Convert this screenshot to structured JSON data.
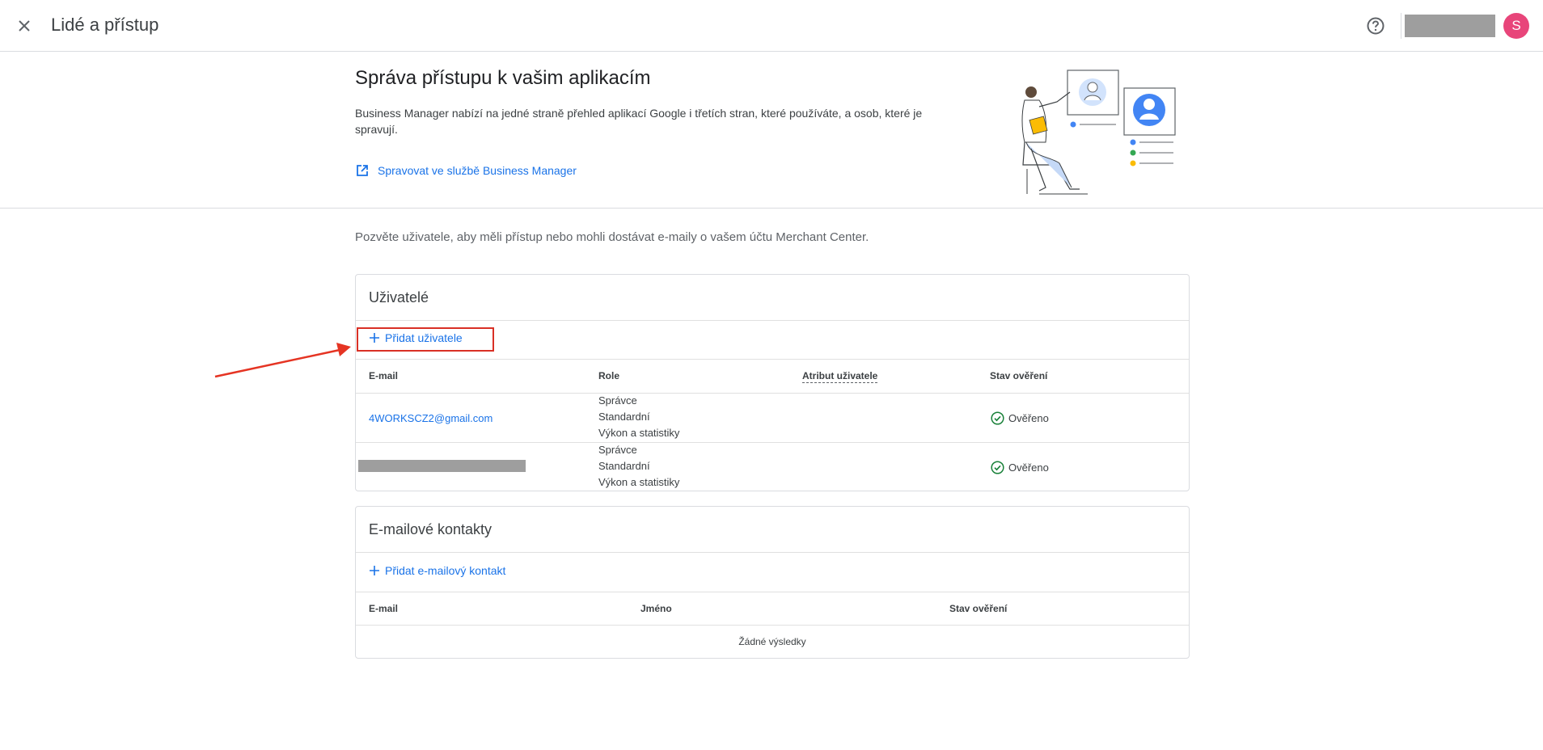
{
  "header": {
    "title": "Lidé a přístup",
    "avatar_letter": "S"
  },
  "hero": {
    "title": "Správa přístupu k vašim aplikacím",
    "description": "Business Manager nabízí na jedné straně přehled aplikací Google i třetích stran, které používáte, a osob, které je spravují.",
    "link_label": "Spravovat ve službě Business Manager"
  },
  "intro": "Pozvěte uživatele, aby měli přístup nebo mohli dostávat e-maily o vašem účtu Merchant Center.",
  "users": {
    "title": "Uživatelé",
    "add_label": "Přidat uživatele",
    "columns": [
      "E-mail",
      "Role",
      "Atribut uživatele",
      "Stav ověření"
    ],
    "rows": [
      {
        "email": "4WORKSCZ2@gmail.com",
        "roles": [
          "Správce",
          "Standardní",
          "Výkon a statistiky"
        ],
        "status": "Ověřeno"
      },
      {
        "email": "",
        "roles": [
          "Správce",
          "Standardní",
          "Výkon a statistiky"
        ],
        "status": "Ověřeno"
      }
    ]
  },
  "contacts": {
    "title": "E-mailové kontakty",
    "add_label": "Přidat e-mailový kontakt",
    "columns": [
      "E-mail",
      "Jméno",
      "Stav ověření"
    ],
    "empty": "Žádné výsledky"
  },
  "colors": {
    "accent": "#1a73e8",
    "verified": "#188038",
    "highlight": "#d93025",
    "avatar": "#e8457a"
  }
}
